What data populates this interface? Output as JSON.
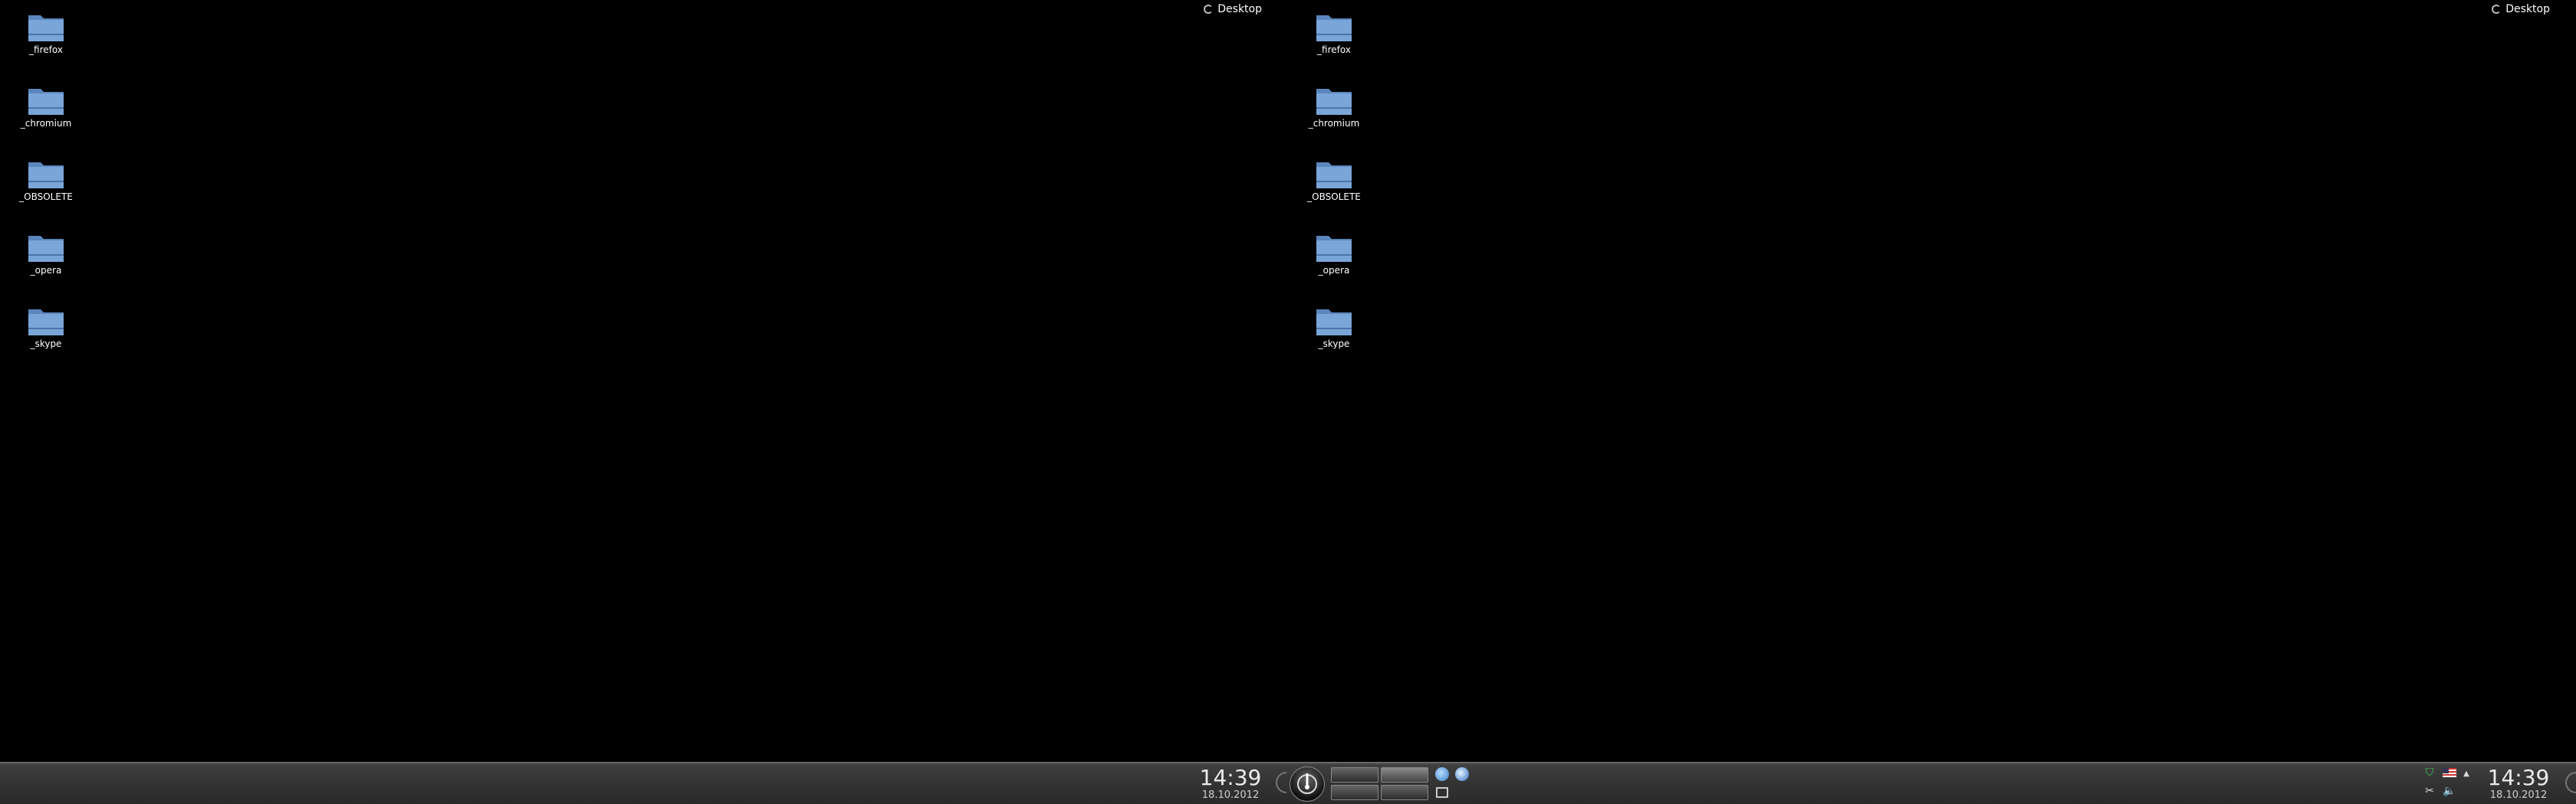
{
  "screens": [
    {
      "toolbox_label": "Desktop",
      "icons": [
        {
          "label": "_firefox"
        },
        {
          "label": "_chromium"
        },
        {
          "label": "_OBSOLETE"
        },
        {
          "label": "_opera"
        },
        {
          "label": "_skype"
        }
      ]
    },
    {
      "toolbox_label": "Desktop",
      "icons": [
        {
          "label": "_firefox"
        },
        {
          "label": "_chromium"
        },
        {
          "label": "_OBSOLETE"
        },
        {
          "label": "_opera"
        },
        {
          "label": "_skype"
        }
      ]
    }
  ],
  "panel": {
    "clock_left": {
      "time": "14:39",
      "date": "18.10.2012"
    },
    "clock_right": {
      "time": "14:39",
      "date": "18.10.2012"
    },
    "icons": {
      "kickoff": "kde-launcher-icon",
      "task1": "globe-icon",
      "task2": "chat-icon",
      "show_desktop": "show-desktop-icon",
      "tray": [
        "network-icon",
        "us-flag-icon",
        "expand-arrow-icon",
        "scissors-icon",
        "volume-icon"
      ]
    }
  },
  "colors": {
    "background": "#000000",
    "folder": "#7aa5d8",
    "panel": "#3a3a3a"
  }
}
